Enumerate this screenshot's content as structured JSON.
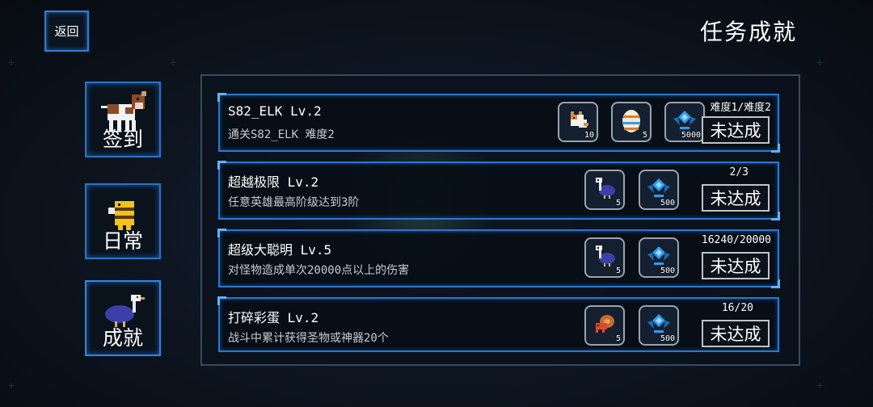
{
  "header": {
    "back_label": "返回",
    "title": "任务成就"
  },
  "tabs": [
    {
      "label": "签到"
    },
    {
      "label": "日常"
    },
    {
      "label": "成就"
    }
  ],
  "achievements": [
    {
      "title": "S82_ELK Lv.2",
      "description": "通关S82_ELK 难度2",
      "progress": "难度1/难度2",
      "status": "未达成",
      "rewards": [
        {
          "icon": "cat-pet-icon",
          "count": "10"
        },
        {
          "icon": "egg-icon",
          "count": "5"
        },
        {
          "icon": "blue-gem-icon",
          "count": "5000"
        }
      ]
    },
    {
      "title": "超越极限 Lv.2",
      "description": "任意英雄最高阶级达到3阶",
      "progress": "2/3",
      "status": "未达成",
      "rewards": [
        {
          "icon": "ostrich-pet-icon",
          "count": "5"
        },
        {
          "icon": "blue-gem-icon",
          "count": "500"
        }
      ]
    },
    {
      "title": "超级大聪明 Lv.5",
      "description": "对怪物造成单次20000点以上的伤害",
      "progress": "16240/20000",
      "status": "未达成",
      "rewards": [
        {
          "icon": "ostrich-pet-icon",
          "count": "5"
        },
        {
          "icon": "blue-gem-icon",
          "count": "500"
        }
      ]
    },
    {
      "title": "打碎彩蛋 Lv.2",
      "description": "战斗中累计获得圣物或神器20个",
      "progress": "16/20",
      "status": "未达成",
      "rewards": [
        {
          "icon": "hermit-crab-pet-icon",
          "count": "5"
        },
        {
          "icon": "blue-gem-icon",
          "count": "500"
        }
      ]
    }
  ],
  "colors": {
    "frame_blue": "#2a78d0",
    "gem_blue": "#2a9df4",
    "panel_bg": "#0a121c"
  }
}
